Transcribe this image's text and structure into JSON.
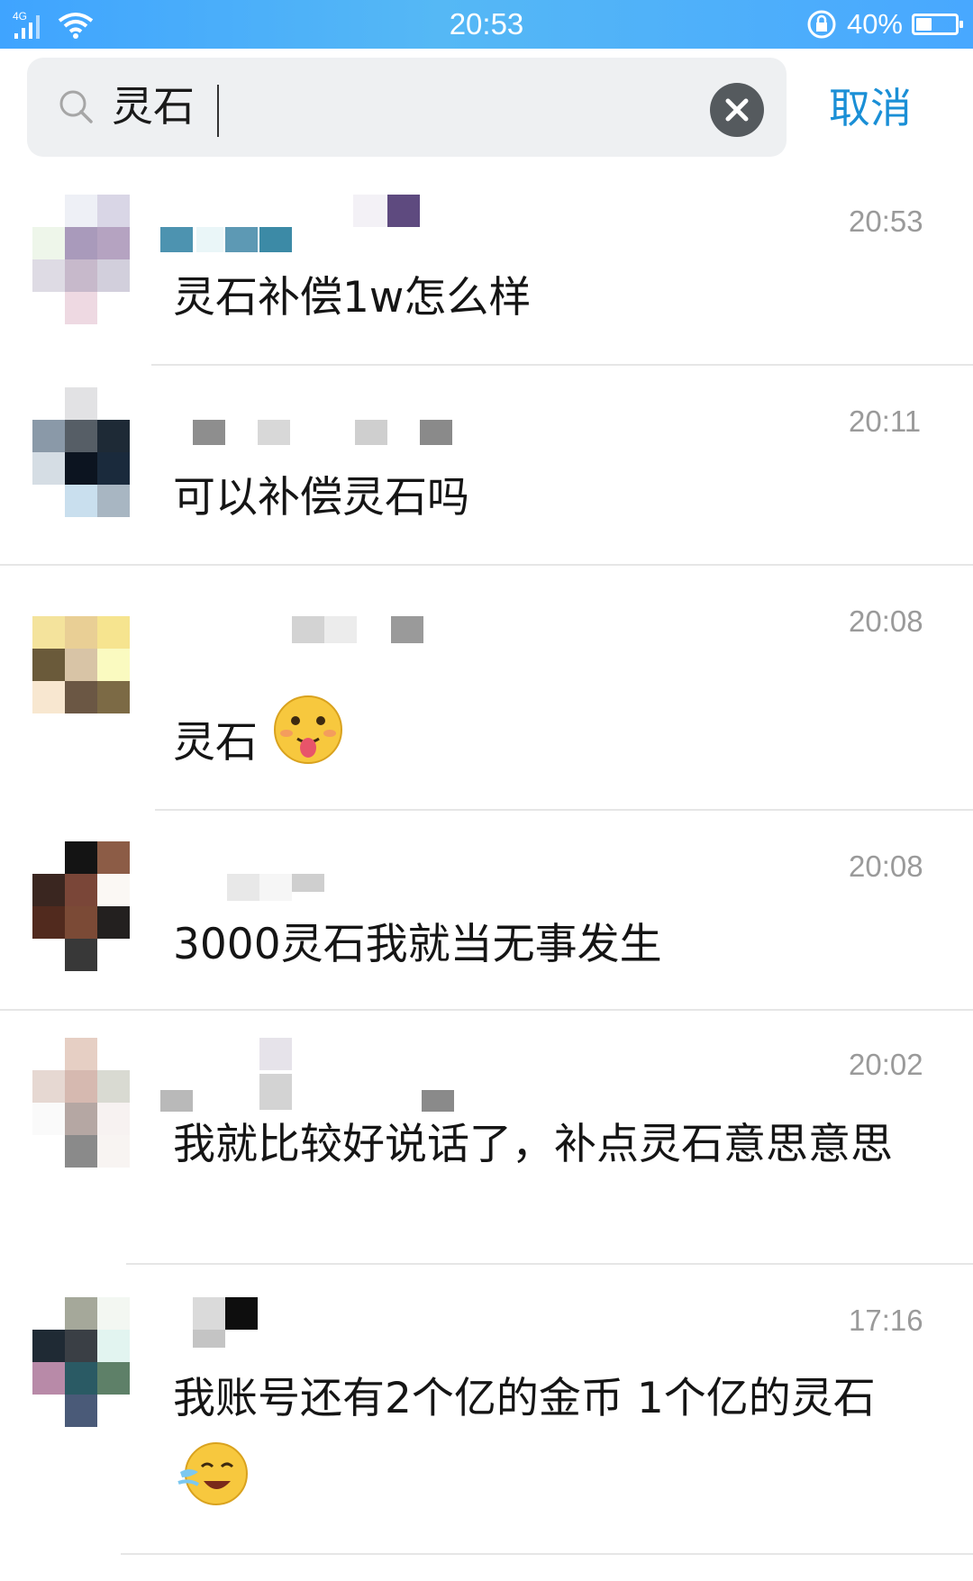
{
  "status_bar": {
    "signal": "4G",
    "time": "20:53",
    "battery": "40%",
    "battery_level": 0.4
  },
  "search": {
    "query": "灵石",
    "cancel_label": "取消"
  },
  "results": [
    {
      "time": "20:53",
      "message": "灵石补偿1w怎么样"
    },
    {
      "time": "20:11",
      "message": "可以补偿灵石吗"
    },
    {
      "time": "20:08",
      "message": "灵石",
      "emoji": "tongue-out-emoji"
    },
    {
      "time": "20:08",
      "message": "3000灵石我就当无事发生"
    },
    {
      "time": "20:02",
      "message": "我就比较好说话了，补点灵石意思意思"
    },
    {
      "time": "17:16",
      "message": "我账号还有2个亿的金币 1个亿的灵石",
      "emoji": "crying-laughing-emoji"
    }
  ],
  "colors": {
    "status_bar": "#48a8ff",
    "accent": "#1a8fd6",
    "search_bg": "#eef0f2"
  }
}
